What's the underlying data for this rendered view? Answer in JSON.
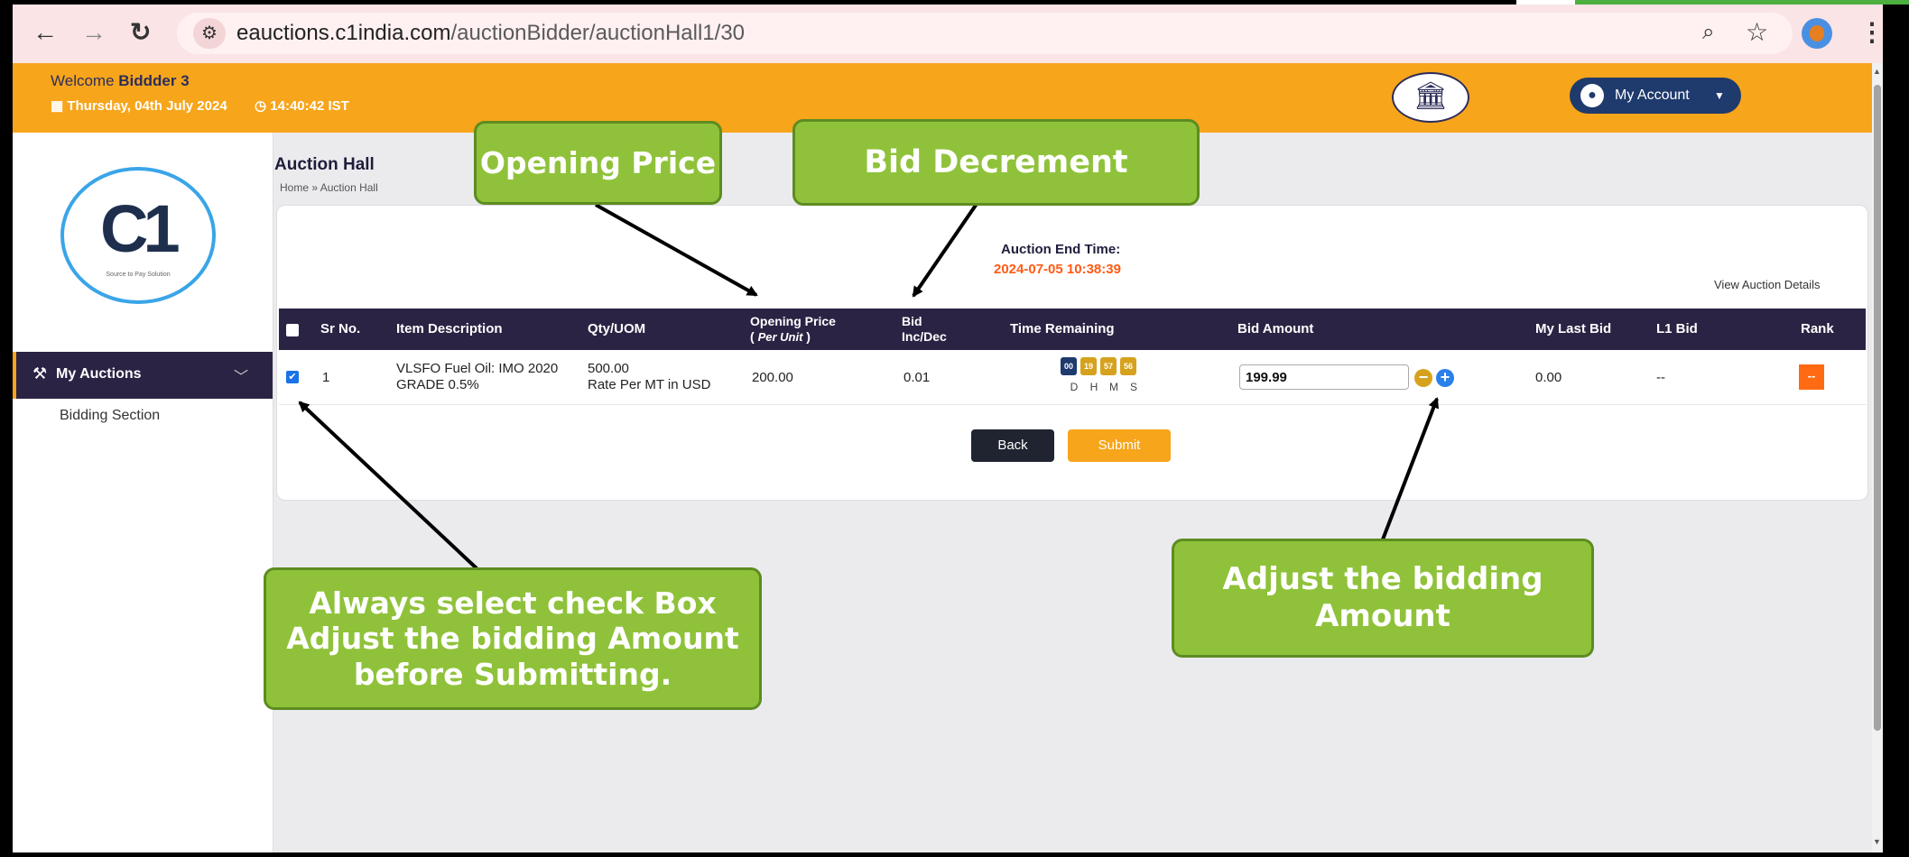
{
  "browser": {
    "url_domain": "eauctions.c1india.com",
    "url_path": "/auctionBidder/auctionHall1/30",
    "icons": [
      "back-arrow-icon",
      "forward-arrow-icon",
      "reload-icon",
      "site-settings-icon",
      "zoom-icon",
      "bookmark-star-icon",
      "profile-icon",
      "kebab-menu-icon"
    ]
  },
  "header": {
    "welcome_prefix": "Welcome",
    "user": "Biddder 3",
    "date": "Thursday, 04th July 2024",
    "time": "14:40:42 IST",
    "account_label": "My Account"
  },
  "sidebar": {
    "logo_text": "C1",
    "logo_tagline": "Source to Pay Solution",
    "menu_label": "My Auctions",
    "submenu_label": "Bidding Section"
  },
  "page": {
    "title": "Auction Hall",
    "breadcrumb_home": "Home",
    "breadcrumb_sep": "»",
    "breadcrumb_current": "Auction Hall",
    "end_time_label": "Auction End Time:",
    "end_time_value": "2024-07-05 10:38:39",
    "view_details": "View Auction Details"
  },
  "table": {
    "headers": {
      "sr": "Sr No.",
      "item": "Item Description",
      "qty": "Qty/UOM",
      "opening_line1": "Opening Price",
      "opening_line2": "Per Unit",
      "bid_line1": "Bid",
      "bid_line2": "Inc/Dec",
      "time": "Time Remaining",
      "amount": "Bid Amount",
      "last": "My Last Bid",
      "l1": "L1 Bid",
      "rank": "Rank"
    },
    "row": {
      "sr": "1",
      "item_line1": "VLSFO Fuel Oil: IMO 2020",
      "item_line2": "GRADE 0.5%",
      "qty_line1": "500.00",
      "qty_line2": "Rate Per MT in USD",
      "opening": "200.00",
      "bid_step": "0.01",
      "timer": {
        "d": "00",
        "h": "19",
        "m": "57",
        "s": "56"
      },
      "timer_labels": {
        "d": "D",
        "h": "H",
        "m": "M",
        "s": "S"
      },
      "bid_amount": "199.99",
      "my_last_bid": "0.00",
      "l1_bid": "--",
      "rank": "--",
      "selected": true
    },
    "colors": {
      "timer_d": "#1f3a6d",
      "timer_h": "#d6a21e",
      "timer_m": "#d6a21e",
      "timer_s": "#d6a21e"
    }
  },
  "buttons": {
    "back": "Back",
    "submit": "Submit"
  },
  "callouts": {
    "opening_price": "Opening Price",
    "bid_decrement": "Bid Decrement",
    "checkbox_line1": "Always select check Box",
    "checkbox_line2": "Adjust the bidding Amount",
    "checkbox_line3": "before Submitting.",
    "adjust_amount": "Adjust the bidding Amount"
  },
  "theme": {
    "accent_orange": "#f7a51b",
    "navy": "#2b2344",
    "callout_green": "#8fc23a",
    "end_time_red": "#ff5a14"
  }
}
